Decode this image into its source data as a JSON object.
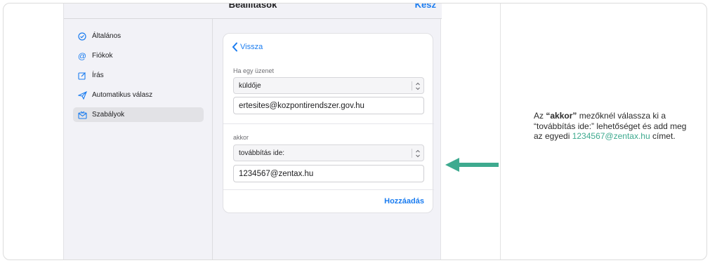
{
  "header": {
    "title": "Beállítások",
    "done": "Kész"
  },
  "sidebar": {
    "items": [
      {
        "label": "Általános",
        "icon": "checkmark-circle-icon"
      },
      {
        "label": "Fiókok",
        "icon": "at-icon"
      },
      {
        "label": "Írás",
        "icon": "compose-icon"
      },
      {
        "label": "Automatikus válasz",
        "icon": "paper-plane-icon"
      },
      {
        "label": "Szabályok",
        "icon": "envelope-rules-icon",
        "active": true
      }
    ]
  },
  "rule": {
    "back": "Vissza",
    "condition_label": "Ha egy üzenet",
    "condition_select": "küldője",
    "condition_value": "ertesites@kozpontirendszer.gov.hu",
    "action_label": "akkor",
    "action_select": "továbbítás ide:",
    "action_value": "1234567@zentax.hu",
    "add": "Hozzáadás"
  },
  "note": {
    "p1": "Az ",
    "p2": "“akkor”",
    "p3": " mezőknél válassza ki a “továbbítás ide:” lehetőséget és add meg az egyedi ",
    "p4": "1234567@zentax.hu",
    "p5": " címet."
  },
  "colors": {
    "accent": "#1a7cf0",
    "arrow": "#3eaa8f",
    "highlight": "#3eaa8f"
  }
}
